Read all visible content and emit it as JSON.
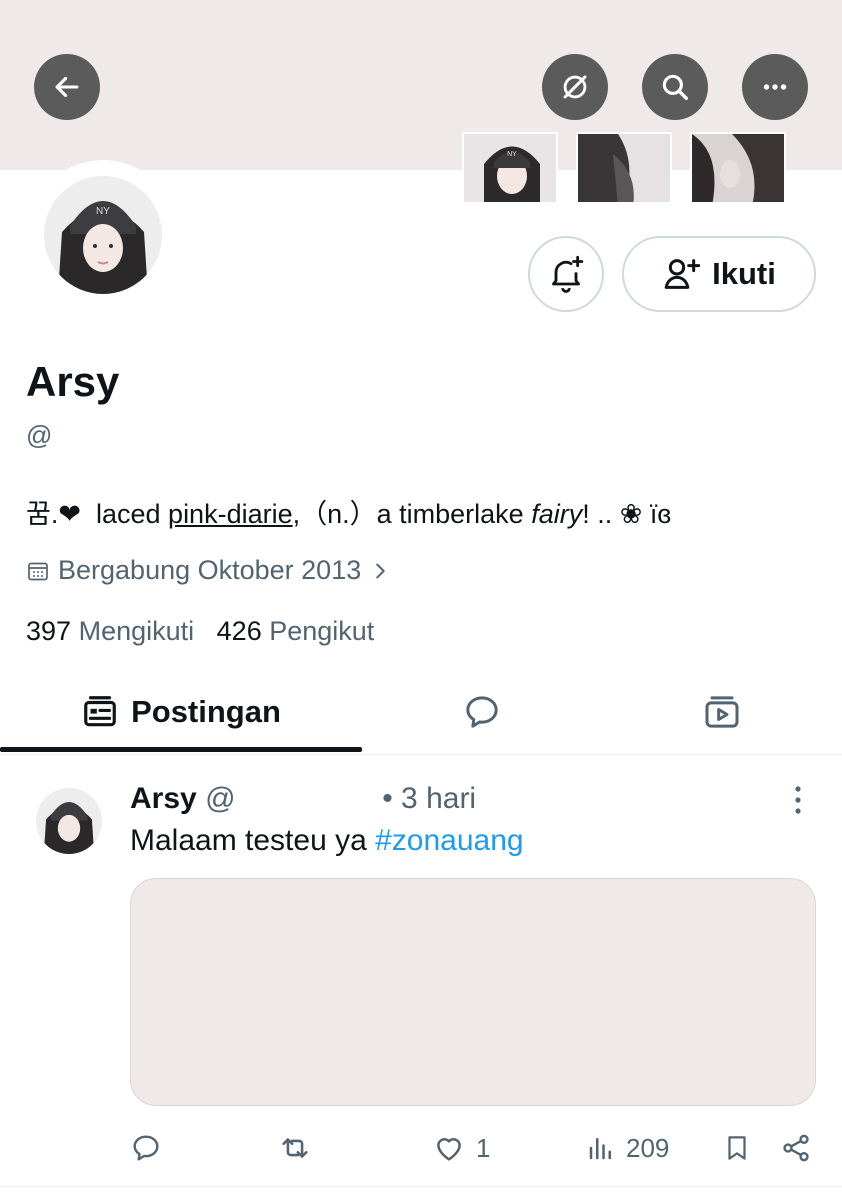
{
  "profile": {
    "name": "Arsy",
    "handle": "@",
    "bio": {
      "prefix": "꿈.❤",
      "text1": "laced",
      "link1": "pink-diarie",
      "text2": ",（n.）a timberlake",
      "italic": "fairy",
      "text3": "!  .. ❀ ïɞ"
    },
    "joined": "Bergabung Oktober 2013",
    "following_count": "397",
    "following_label": "Mengikuti",
    "followers_count": "426",
    "followers_label": "Pengikut",
    "follow_button": "Ikuti"
  },
  "tabs": {
    "posts_label": "Postingan"
  },
  "post": {
    "author": "Arsy",
    "handle": "@",
    "time": "• 3 hari",
    "text": "Malaam testeu ya",
    "hashtag": "#zonauang",
    "likes": "1",
    "views": "209"
  },
  "colors": {
    "banner": "#efe9ea",
    "accent_link": "#1d9bf0",
    "muted_text": "#536471",
    "button_dark": "#5b5b5b"
  }
}
